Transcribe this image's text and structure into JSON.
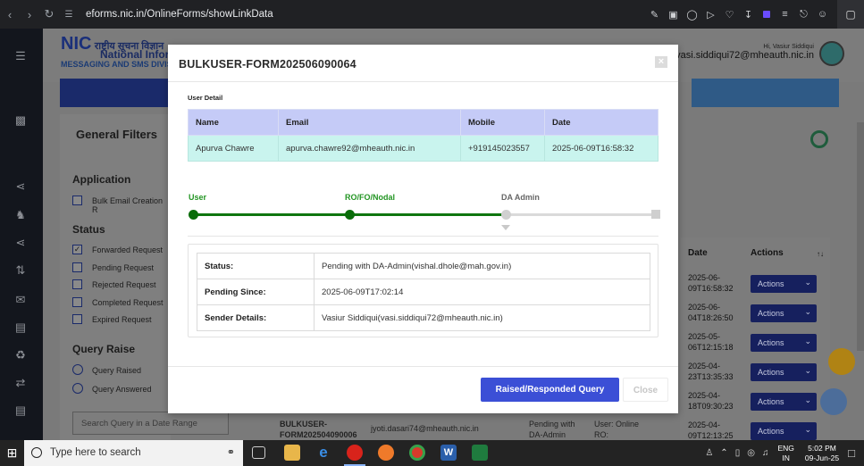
{
  "browser": {
    "url": "eforms.nic.in/OnlineForms/showLinkData",
    "icons": [
      "back-icon",
      "forward-icon",
      "reload-icon",
      "tune-icon",
      "edit-icon",
      "camera-icon",
      "shield-icon",
      "play-icon",
      "heart-icon",
      "download-icon",
      "extension-icon",
      "menu-icon",
      "lock-icon",
      "profile-icon",
      "cube-icon"
    ]
  },
  "header": {
    "logo_hindi": "राष्ट्रीय सूचना विज्ञान",
    "logo_title": "National Inform",
    "logo_sub": "MESSAGING AND SMS DIVIS",
    "user_greeting": "Hi, Vasiur Siddiqui",
    "user_email": "vasi.siddiqui72@mheauth.nic.in"
  },
  "filters": {
    "title": "General Filters",
    "application_heading": "Application",
    "application_items": [
      "Bulk Email Creation R"
    ],
    "status_heading": "Status",
    "status_items": [
      {
        "label": "Forwarded Request",
        "checked": true
      },
      {
        "label": "Pending Request",
        "checked": false
      },
      {
        "label": "Rejected Request",
        "checked": false
      },
      {
        "label": "Completed Request",
        "checked": false
      },
      {
        "label": "Expired Request",
        "checked": false
      }
    ],
    "query_heading": "Query Raise",
    "query_items": [
      "Query Raised",
      "Query Answered"
    ],
    "date_range_placeholder": "Search Query in a Date Range"
  },
  "bg_table": {
    "date_header": "Date",
    "actions_header": "Actions",
    "sort_icon": "↑↓",
    "rows": [
      {
        "date": "2025-06-\n09T16:58:32",
        "action": "Actions"
      },
      {
        "date": "2025-06-\n04T18:26:50",
        "action": "Actions"
      },
      {
        "date": "2025-05-\n06T12:15:18",
        "action": "Actions"
      },
      {
        "date": "2025-04-\n23T13:35:33",
        "action": "Actions"
      },
      {
        "date": "2025-04-\n18T09:30:23",
        "action": "Actions"
      },
      {
        "date": "2025-04-\n09T12:13:25",
        "action": "Actions"
      }
    ],
    "bottom_row": {
      "form_id": "BULKUSER-\nFORM202504090006",
      "email": "jyoti.dasari74@mheauth.nic.in",
      "status": "Pending with\nDA-Admin",
      "user": "User: Online\nRO:"
    }
  },
  "modal": {
    "title": "BULKUSER-FORM202506090064",
    "close_x": "×",
    "user_detail_label": "User Detail",
    "user_table": {
      "headers": [
        "Name",
        "Email",
        "Mobile",
        "Date"
      ],
      "row": [
        "Apurva Chawre",
        "apurva.chawre92@mheauth.nic.in",
        "+919145023557",
        "2025-06-09T16:58:32"
      ]
    },
    "stages": [
      {
        "label": "User",
        "state": "done"
      },
      {
        "label": "RO/FO/Nodal",
        "state": "done"
      },
      {
        "label": "DA Admin",
        "state": "pending"
      }
    ],
    "status_rows": [
      {
        "key": "Status:",
        "value": "Pending with DA-Admin(vishal.dhole@mah.gov.in)"
      },
      {
        "key": "Pending Since:",
        "value": "2025-06-09T17:02:14"
      },
      {
        "key": "Sender Details:",
        "value": "Vasiur Siddiqui(vasi.siddiqui72@mheauth.nic.in)"
      }
    ],
    "raised_button": "Raised/Responded Query",
    "close_button": "Close"
  },
  "taskbar": {
    "search_placeholder": "Type here to search",
    "lang_line1": "ENG",
    "lang_line2": "IN",
    "time": "5:02 PM",
    "date": "09-Jun-25"
  },
  "colors": {
    "primary_blue": "#3b4fd6",
    "table_header": "#c5cbf7",
    "table_row": "#c9f4ee",
    "progress_done": "#0f760f",
    "stage_done_text": "#239523"
  }
}
